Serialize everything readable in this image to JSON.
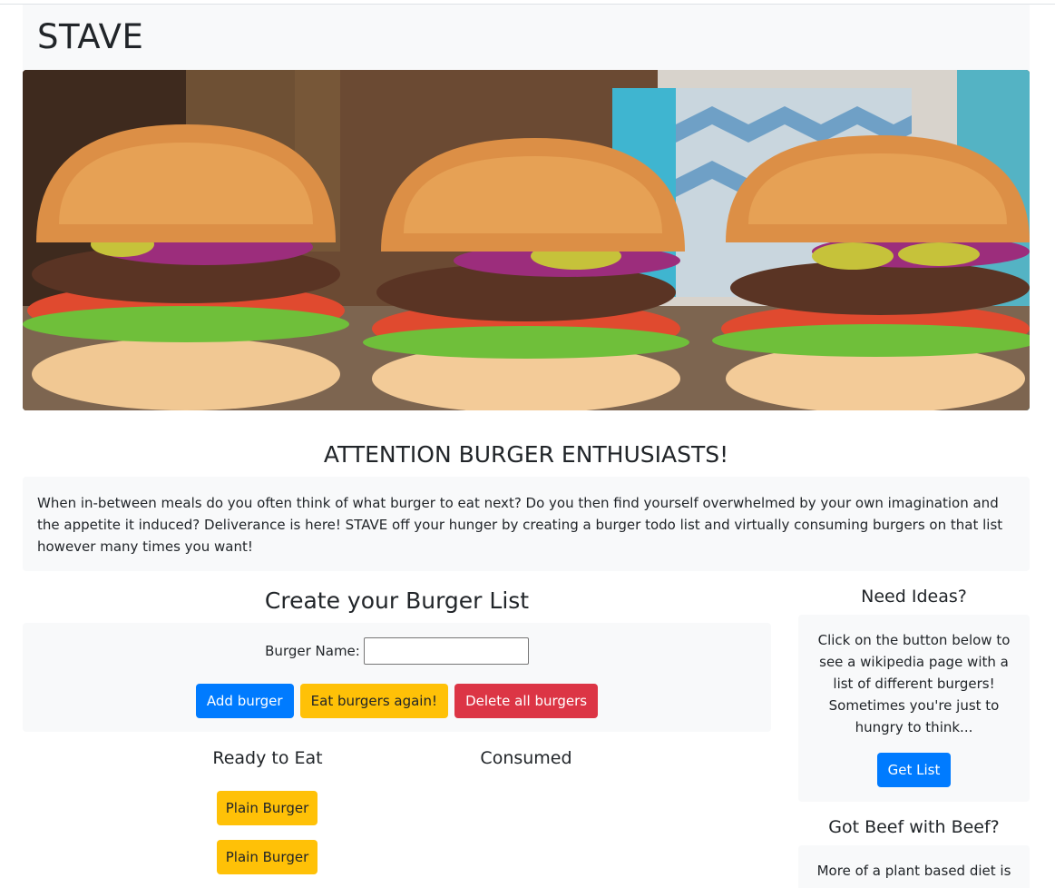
{
  "header": {
    "brand": "STAVE"
  },
  "hero": {
    "alt_icon": "burgers-photo"
  },
  "intro": {
    "heading": "ATTENTION BURGER ENTHUSIASTS!",
    "text": "When in-between meals do you often think of what burger to eat next? Do you then find yourself overwhelmed by your own imagination and the appetite it induced? Deliverance is here! STAVE off your hunger by creating a burger todo list and virtually consuming burgers on that list however many times you want!"
  },
  "create": {
    "heading": "Create your Burger List",
    "name_label": "Burger Name:",
    "name_value": "",
    "add_label": "Add burger",
    "eat_again_label": "Eat burgers again!",
    "delete_all_label": "Delete all burgers"
  },
  "lists": {
    "ready_heading": "Ready to Eat",
    "consumed_heading": "Consumed",
    "ready_items": [
      "Plain Burger",
      "Plain Burger"
    ]
  },
  "sidebar": {
    "ideas_heading": "Need Ideas?",
    "ideas_text": "Click on the button below to see a wikipedia page with a list of different burgers! Sometimes you're just to hungry to think...",
    "ideas_button": "Get List",
    "beef_heading": "Got Beef with Beef?",
    "beef_text": "More of a plant based diet is"
  },
  "colors": {
    "primary": "#007bff",
    "warning": "#ffc107",
    "danger": "#dc3545",
    "panel": "#f8f9fa"
  }
}
